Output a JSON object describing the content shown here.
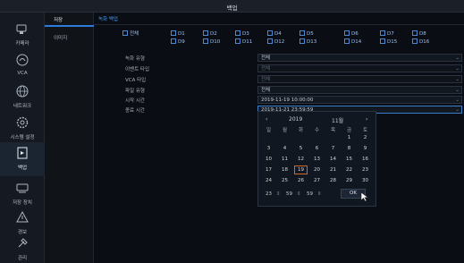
{
  "window": {
    "title": "백업"
  },
  "nav": {
    "items": [
      {
        "label": "카메라",
        "icon": "camera-icon"
      },
      {
        "label": "VCA",
        "icon": "vca-icon"
      },
      {
        "label": "네트워크",
        "icon": "network-icon"
      },
      {
        "label": "시스템 설정",
        "icon": "settings-icon"
      },
      {
        "label": "백업",
        "icon": "backup-icon",
        "active": true
      },
      {
        "label": "저장 장치",
        "icon": "storage-icon"
      },
      {
        "label": "경보",
        "icon": "alarm-icon"
      },
      {
        "label": "관리",
        "icon": "admin-icon"
      }
    ]
  },
  "subnav": {
    "items": [
      {
        "label": "저장",
        "active": true
      },
      {
        "label": "이미지"
      }
    ]
  },
  "tabs": [
    {
      "label": "녹화 백업"
    }
  ],
  "channels": {
    "all_label": "전체",
    "row1": [
      "D1",
      "D2",
      "D3",
      "D4",
      "D5",
      "D6",
      "D7",
      "D8"
    ],
    "row2": [
      "D9",
      "D10",
      "D11",
      "D12",
      "D13",
      "D14",
      "D15",
      "D16"
    ]
  },
  "form": {
    "record_type": {
      "label": "녹화 유형",
      "value": "전체"
    },
    "event_type": {
      "label": "이벤트 타입",
      "value": "전체"
    },
    "vca_type": {
      "label": "VCA 타입",
      "value": "전체"
    },
    "file_type": {
      "label": "파일 유형",
      "value": "전체"
    },
    "start_time": {
      "label": "시작 시간",
      "value": "2019-11-19 10:00:00"
    },
    "end_time": {
      "label": "종료 시간",
      "value": "2019-11-21 23:59:59"
    }
  },
  "calendar": {
    "prev": "‹",
    "next": "›",
    "year": "2019",
    "month": "11월",
    "weekdays": [
      "일",
      "월",
      "화",
      "수",
      "목",
      "금",
      "토"
    ],
    "weeks": [
      [
        "",
        "",
        "",
        "",
        "",
        "1",
        "2"
      ],
      [
        "3",
        "4",
        "5",
        "6",
        "7",
        "8",
        "9"
      ],
      [
        "10",
        "11",
        "12",
        "13",
        "14",
        "15",
        "16"
      ],
      [
        "17",
        "18",
        "19",
        "20",
        "21",
        "22",
        "23"
      ],
      [
        "24",
        "25",
        "26",
        "27",
        "28",
        "29",
        "30"
      ]
    ],
    "selected": "19",
    "time": {
      "hour": "23",
      "minute": "59",
      "second": "59"
    },
    "ok_label": "OK"
  },
  "colors": {
    "accent": "#2e7bd8",
    "selection": "#d06a2c",
    "checkbox": "#4d8ad4"
  }
}
